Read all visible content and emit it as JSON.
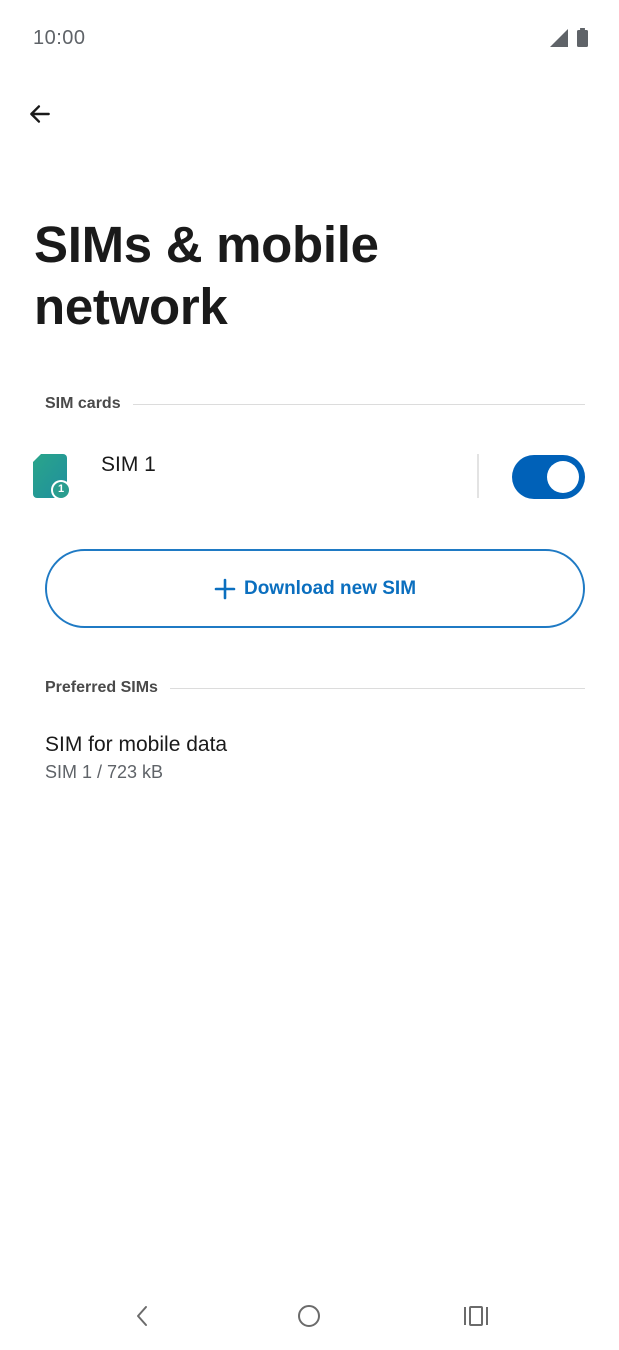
{
  "status_bar": {
    "time": "10:00",
    "icons": [
      "cell-signal-icon",
      "battery-icon"
    ]
  },
  "header": {
    "back_icon": "arrow-back-icon",
    "title": "SIMs & mobile network"
  },
  "sim_cards": {
    "section_label": "SIM cards",
    "sim": {
      "label": "SIM 1",
      "badge": "1",
      "icon": "sim-card-icon",
      "enabled": true,
      "icon_color": "#2a9d8f"
    }
  },
  "download": {
    "label": "Download new SIM",
    "icon": "plus-icon"
  },
  "preferred": {
    "section_label": "Preferred SIMs",
    "item": {
      "title": "SIM for mobile data",
      "subtitle": "SIM 1 / 723 kB"
    }
  },
  "nav_bar": {
    "icons": [
      "nav-back-icon",
      "nav-home-icon",
      "nav-recents-icon"
    ]
  },
  "colors": {
    "accent": "#0061b8",
    "button_border": "#1f7ac4",
    "button_text": "#0b6fbf"
  }
}
